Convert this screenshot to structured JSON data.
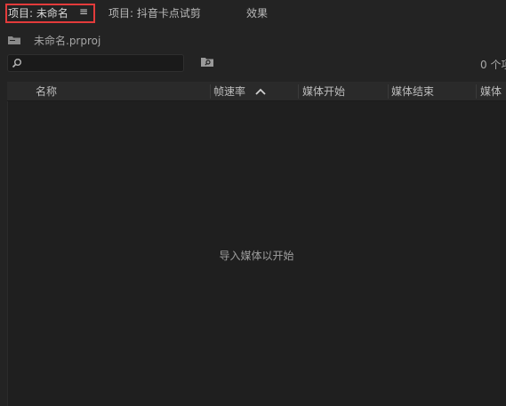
{
  "tabs": [
    {
      "label": "项目: 未命名",
      "active": true
    },
    {
      "label": "项目: 抖音卡点试剪",
      "active": false
    },
    {
      "label": "效果",
      "active": false
    }
  ],
  "tab_menu_symbol": "≡",
  "project": {
    "file_name": "未命名.prproj"
  },
  "search": {
    "placeholder": ""
  },
  "item_count": "0 个项",
  "columns": [
    "名称",
    "帧速率",
    "媒体开始",
    "媒体结束",
    "媒体"
  ],
  "sorted_column": "帧速率",
  "empty_message": "导入媒体以开始",
  "colors": {
    "highlight": "#e33b3b",
    "background": "#232323"
  }
}
